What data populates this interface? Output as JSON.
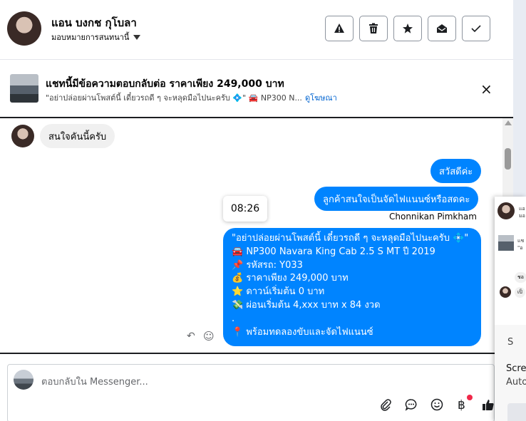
{
  "header": {
    "contact_name": "แอน บงกช กุโบลา",
    "subtitle": "มอบหมายการสนทนานี้",
    "buttons": [
      "warning-icon",
      "trash-icon",
      "star-icon",
      "envelope-open-icon",
      "check-icon"
    ]
  },
  "ad": {
    "title": "แชทนี้มีข้อความตอบกลับต่อ ราคาเพียง 249,000 บาท",
    "snippet": "\"อย่าปล่อยผ่านโพสต์นี้ เดี๋ยวรถดี ๆ จะหลุดมือไปนะครับ 💠\" 🚘 NP300 N...",
    "link": "ดูโฆษณา",
    "close": "×"
  },
  "messages": {
    "incoming_1": "สนใจคันนี้ครับ",
    "outgoing_1": "สวัสดีค่ะ",
    "outgoing_2": "ลูกค้าสนใจเป็นจัดไฟแนนซ์หรือสดคะ",
    "sender": "Chonnikan Pimkham",
    "time_tooltip": "08:26",
    "outgoing_3": [
      "\"อย่าปล่อยผ่านโพสต์นี้ เดี๋ยวรถดี ๆ จะหลุดมือไปนะครับ 💠\"",
      "🚘 NP300 Navara King Cab 2.5 S MT ปี 2019",
      "📌 รหัสรถ: Y033",
      "💰 ราคาเพียง 249,000 บาท",
      "⭐ ดาวน์เริ่มต้น 0 บาท",
      "💸 ผ่อนเริ่มต้น 4,xxx บาท x 84 งวด",
      ".",
      "📍 พร้อมทดลองขับและจัดไฟแนนซ์"
    ]
  },
  "composer": {
    "placeholder": "ตอบกลับใน Messenger...",
    "icons": [
      "paperclip-icon",
      "chat-bubble-icon",
      "emoji-icon",
      "baht-icon",
      "thumbs-up-icon"
    ]
  },
  "side_panel": {
    "name_fragment": "แอ",
    "sub_fragment": "มอ",
    "ad_fragment": "แช",
    "ad_sub_fragment": "\"อ",
    "bubble_1": "ชอ",
    "bubble_2": "เป็",
    "panel_title": "S",
    "panel_line_1": "Scre",
    "panel_line_2": "Auto"
  },
  "colors": {
    "accent": "#0084ff",
    "incoming_bubble": "#f0f0f0",
    "link": "#0064d1",
    "notification_dot": "#f02849"
  }
}
